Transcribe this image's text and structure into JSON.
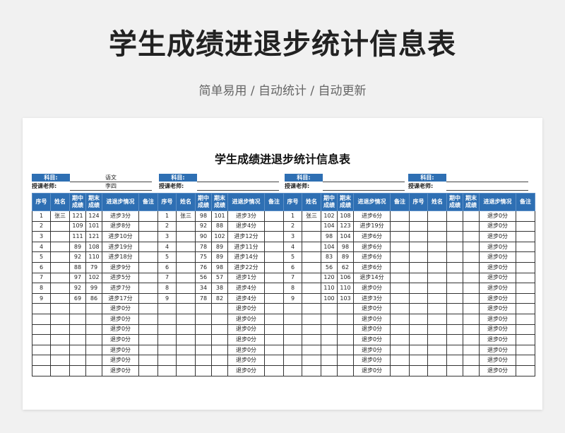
{
  "page": {
    "headline": "学生成绩进退步统计信息表",
    "tagline": "简单易用 / 自动统计 / 自动更新"
  },
  "sheet": {
    "title": "学生成绩进退步统计信息表",
    "subject_label": "科目:",
    "teacher_label": "授课老师:",
    "blocks": [
      {
        "subject": "语文",
        "teacher": "李四"
      },
      {
        "subject": "",
        "teacher": ""
      },
      {
        "subject": "",
        "teacher": ""
      },
      {
        "subject": "",
        "teacher": ""
      }
    ],
    "headers": [
      "序号",
      "姓名",
      "期中成绩",
      "期末成绩",
      "进退步情况",
      "备注"
    ],
    "groups": [
      {
        "rows": [
          [
            "1",
            "张三",
            "121",
            "124",
            "进步3分",
            ""
          ],
          [
            "2",
            "",
            "109",
            "101",
            "退步8分",
            ""
          ],
          [
            "3",
            "",
            "111",
            "121",
            "进步10分",
            ""
          ],
          [
            "4",
            "",
            "89",
            "108",
            "进步19分",
            ""
          ],
          [
            "5",
            "",
            "92",
            "110",
            "进步18分",
            ""
          ],
          [
            "6",
            "",
            "88",
            "79",
            "退步9分",
            ""
          ],
          [
            "7",
            "",
            "97",
            "102",
            "进步5分",
            ""
          ],
          [
            "8",
            "",
            "92",
            "99",
            "进步7分",
            ""
          ],
          [
            "9",
            "",
            "69",
            "86",
            "进步17分",
            ""
          ],
          [
            "",
            "",
            "",
            "",
            "退步0分",
            ""
          ],
          [
            "",
            "",
            "",
            "",
            "退步0分",
            ""
          ],
          [
            "",
            "",
            "",
            "",
            "退步0分",
            ""
          ],
          [
            "",
            "",
            "",
            "",
            "退步0分",
            ""
          ],
          [
            "",
            "",
            "",
            "",
            "退步0分",
            ""
          ],
          [
            "",
            "",
            "",
            "",
            "退步0分",
            ""
          ],
          [
            "",
            "",
            "",
            "",
            "退步0分",
            ""
          ]
        ]
      },
      {
        "rows": [
          [
            "1",
            "张三",
            "98",
            "101",
            "进步3分",
            ""
          ],
          [
            "2",
            "",
            "92",
            "88",
            "退步4分",
            ""
          ],
          [
            "3",
            "",
            "90",
            "102",
            "进步12分",
            ""
          ],
          [
            "4",
            "",
            "78",
            "89",
            "进步11分",
            ""
          ],
          [
            "5",
            "",
            "75",
            "89",
            "进步14分",
            ""
          ],
          [
            "6",
            "",
            "76",
            "98",
            "进步22分",
            ""
          ],
          [
            "7",
            "",
            "56",
            "57",
            "进步1分",
            ""
          ],
          [
            "8",
            "",
            "34",
            "38",
            "进步4分",
            ""
          ],
          [
            "9",
            "",
            "78",
            "82",
            "进步4分",
            ""
          ],
          [
            "",
            "",
            "",
            "",
            "退步0分",
            ""
          ],
          [
            "",
            "",
            "",
            "",
            "退步0分",
            ""
          ],
          [
            "",
            "",
            "",
            "",
            "退步0分",
            ""
          ],
          [
            "",
            "",
            "",
            "",
            "退步0分",
            ""
          ],
          [
            "",
            "",
            "",
            "",
            "退步0分",
            ""
          ],
          [
            "",
            "",
            "",
            "",
            "退步0分",
            ""
          ],
          [
            "",
            "",
            "",
            "",
            "退步0分",
            ""
          ]
        ]
      },
      {
        "rows": [
          [
            "1",
            "张三",
            "102",
            "108",
            "进步6分",
            ""
          ],
          [
            "2",
            "",
            "104",
            "123",
            "进步19分",
            ""
          ],
          [
            "3",
            "",
            "98",
            "104",
            "进步6分",
            ""
          ],
          [
            "4",
            "",
            "104",
            "98",
            "退步6分",
            ""
          ],
          [
            "5",
            "",
            "83",
            "89",
            "进步6分",
            ""
          ],
          [
            "6",
            "",
            "56",
            "62",
            "进步6分",
            ""
          ],
          [
            "7",
            "",
            "120",
            "106",
            "退步14分",
            ""
          ],
          [
            "8",
            "",
            "110",
            "110",
            "退步0分",
            ""
          ],
          [
            "9",
            "",
            "100",
            "103",
            "进步3分",
            ""
          ],
          [
            "",
            "",
            "",
            "",
            "退步0分",
            ""
          ],
          [
            "",
            "",
            "",
            "",
            "退步0分",
            ""
          ],
          [
            "",
            "",
            "",
            "",
            "退步0分",
            ""
          ],
          [
            "",
            "",
            "",
            "",
            "退步0分",
            ""
          ],
          [
            "",
            "",
            "",
            "",
            "退步0分",
            ""
          ],
          [
            "",
            "",
            "",
            "",
            "退步0分",
            ""
          ],
          [
            "",
            "",
            "",
            "",
            "退步0分",
            ""
          ]
        ]
      },
      {
        "rows": [
          [
            "",
            "",
            "",
            "",
            "退步0分",
            ""
          ],
          [
            "",
            "",
            "",
            "",
            "退步0分",
            ""
          ],
          [
            "",
            "",
            "",
            "",
            "退步0分",
            ""
          ],
          [
            "",
            "",
            "",
            "",
            "退步0分",
            ""
          ],
          [
            "",
            "",
            "",
            "",
            "退步0分",
            ""
          ],
          [
            "",
            "",
            "",
            "",
            "退步0分",
            ""
          ],
          [
            "",
            "",
            "",
            "",
            "退步0分",
            ""
          ],
          [
            "",
            "",
            "",
            "",
            "退步0分",
            ""
          ],
          [
            "",
            "",
            "",
            "",
            "退步0分",
            ""
          ],
          [
            "",
            "",
            "",
            "",
            "退步0分",
            ""
          ],
          [
            "",
            "",
            "",
            "",
            "退步0分",
            ""
          ],
          [
            "",
            "",
            "",
            "",
            "退步0分",
            ""
          ],
          [
            "",
            "",
            "",
            "",
            "退步0分",
            ""
          ],
          [
            "",
            "",
            "",
            "",
            "退步0分",
            ""
          ],
          [
            "",
            "",
            "",
            "",
            "退步0分",
            ""
          ],
          [
            "",
            "",
            "",
            "",
            "退步0分",
            ""
          ]
        ]
      }
    ]
  }
}
